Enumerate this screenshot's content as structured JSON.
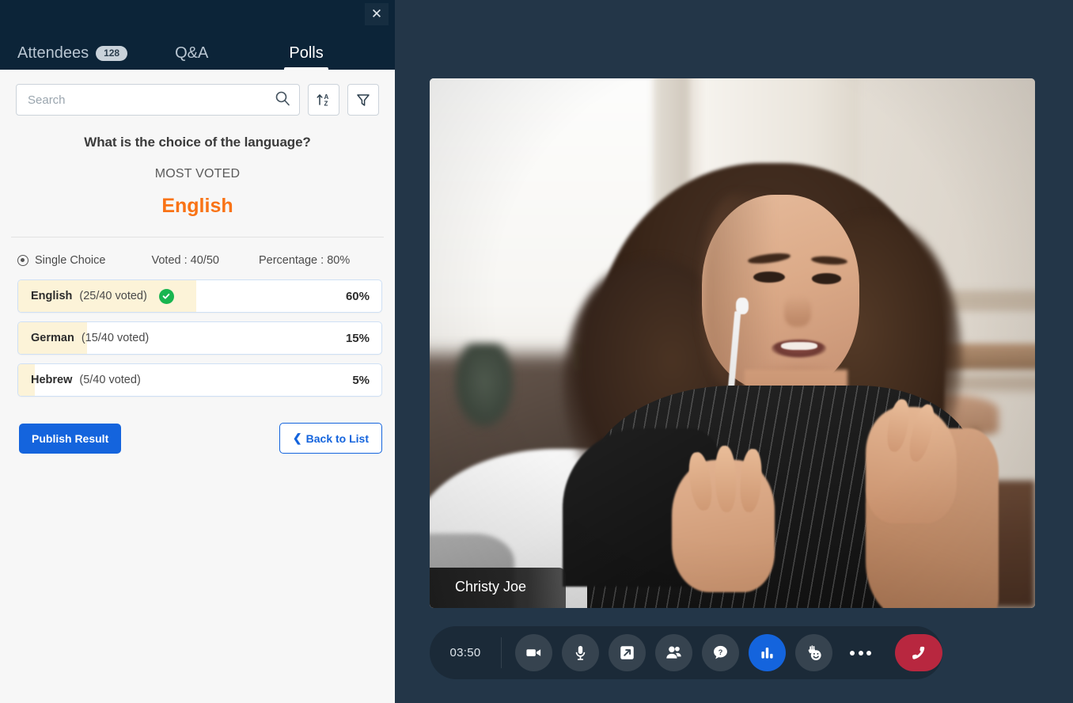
{
  "panel": {
    "close_label": "✕",
    "tabs": [
      {
        "label": "Attendees",
        "badge": "128",
        "active": false
      },
      {
        "label": "Q&A",
        "badge": "",
        "active": false
      },
      {
        "label": "Polls",
        "badge": "",
        "active": true
      }
    ],
    "search": {
      "placeholder": "Search",
      "value": ""
    },
    "toolbar": {
      "sort_label": "sort-az",
      "filter_label": "filter"
    }
  },
  "poll": {
    "question": "What is the choice of the language?",
    "most_voted_label": "MOST VOTED",
    "winner": "English",
    "type_label": "Single Choice",
    "voted_label": "Voted : 40/50",
    "percentage_label": "Percentage : 80%",
    "options": [
      {
        "name": "English",
        "count": "(25/40 voted)",
        "percent": "60%",
        "fill": 49,
        "selected": true
      },
      {
        "name": "German",
        "count": "(15/40 voted)",
        "percent": "15%",
        "fill": 19,
        "selected": false
      },
      {
        "name": "Hebrew",
        "count": "(5/40 voted)",
        "percent": "5%",
        "fill": 4.6,
        "selected": false
      }
    ],
    "publish_label": "Publish Result",
    "back_label": "Back to List",
    "back_chevron": "❮"
  },
  "stage": {
    "participant_name": "Christy Joe",
    "controls": {
      "timer": "03:50",
      "buttons": [
        {
          "name": "camera-button",
          "icon": "video-camera-icon"
        },
        {
          "name": "microphone-button",
          "icon": "microphone-icon"
        },
        {
          "name": "share-screen-button",
          "icon": "share-screen-icon"
        },
        {
          "name": "participants-button",
          "icon": "participants-icon"
        },
        {
          "name": "qa-button",
          "icon": "question-bubble-icon"
        },
        {
          "name": "polls-button",
          "icon": "bar-chart-icon"
        },
        {
          "name": "reactions-button",
          "icon": "raise-hand-smiley-icon"
        },
        {
          "name": "more-options-button",
          "icon": "ellipsis-icon"
        },
        {
          "name": "hangup-button",
          "icon": "phone-hangup-icon"
        }
      ]
    }
  },
  "colors": {
    "panel_header": "#0c2438",
    "stage_bg": "#233648",
    "accent_orange": "#f97316",
    "accent_blue": "#1464dd",
    "bar_fill": "#fcf3d8",
    "check_green": "#18b550",
    "hangup_red": "#b8273f"
  }
}
